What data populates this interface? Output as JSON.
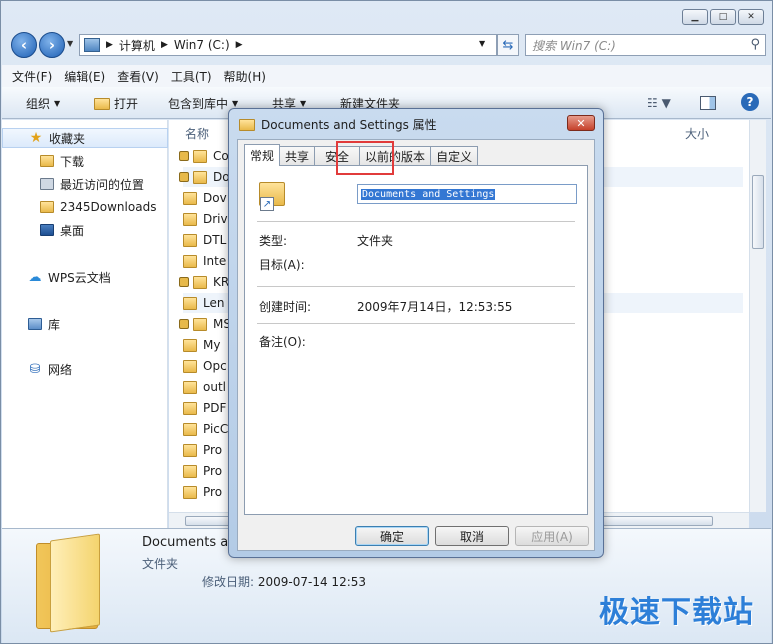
{
  "address": {
    "crumbs": [
      "计算机",
      "Win7 (C:)"
    ],
    "search_placeholder": "搜索 Win7 (C:)"
  },
  "menu": [
    "文件(F)",
    "编辑(E)",
    "查看(V)",
    "工具(T)",
    "帮助(H)"
  ],
  "toolbar": {
    "organize": "组织",
    "open": "打开",
    "include": "包含到库中",
    "share": "共享",
    "new_folder": "新建文件夹"
  },
  "nav": {
    "favorites": "收藏夹",
    "downloads": "下载",
    "recent": "最近访问的位置",
    "d2345": "2345Downloads",
    "desktop": "桌面",
    "wps": "WPS云文档",
    "library": "库",
    "network": "网络"
  },
  "content": {
    "col_name": "名称",
    "col_size": "大小",
    "rows": [
      "Cor",
      "Doc",
      "Dov",
      "Driv",
      "DTL",
      "Inte",
      "KRS",
      "Len",
      "MS(",
      "My",
      "Opc",
      "outl",
      "PDF",
      "PicC",
      "Pro",
      "Pro",
      "Pro"
    ]
  },
  "details": {
    "name": "Documents ar",
    "type": "文件夹",
    "date_label": "修改日期:",
    "date_value": "2009-07-14 12:53"
  },
  "watermark": "极速下载站",
  "dialog": {
    "title": "Documents and Settings 属性",
    "close": "✕",
    "tabs": [
      "常规",
      "共享",
      "安全",
      "以前的版本",
      "自定义"
    ],
    "folder_name": "Documents and Settings",
    "type_label": "类型:",
    "type_value": "文件夹",
    "target_label": "目标(A):",
    "created_label": "创建时间:",
    "created_value": "2009年7月14日，12:53:55",
    "comment_label": "备注(O):",
    "ok": "确定",
    "cancel": "取消",
    "apply": "应用(A)"
  }
}
